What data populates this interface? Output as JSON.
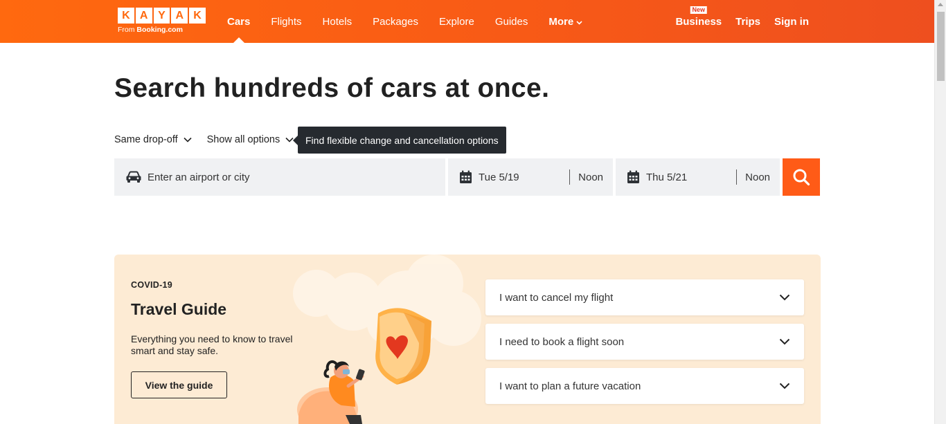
{
  "header": {
    "logo_letters": [
      "K",
      "A",
      "Y",
      "A",
      "K"
    ],
    "logo_from": "From",
    "logo_brand": "Booking.com",
    "nav": [
      {
        "label": "Cars",
        "active": true
      },
      {
        "label": "Flights"
      },
      {
        "label": "Hotels"
      },
      {
        "label": "Packages"
      },
      {
        "label": "Explore"
      },
      {
        "label": "Guides"
      },
      {
        "label": "More",
        "has_dropdown": true
      }
    ],
    "business_badge": "New",
    "business_label": "Business",
    "trips_label": "Trips",
    "signin_label": "Sign in"
  },
  "hero": {
    "title": "Search hundreds of cars at once.",
    "dropoff_option": "Same drop-off",
    "show_options": "Show all options",
    "tooltip": "Find flexible change and cancellation options"
  },
  "search": {
    "location_placeholder": "Enter an airport or city",
    "pickup_date": "Tue 5/19",
    "pickup_time": "Noon",
    "dropoff_date": "Thu 5/21",
    "dropoff_time": "Noon"
  },
  "covid": {
    "tag": "COVID-19",
    "title": "Travel Guide",
    "description": "Everything you need to know to travel smart and stay safe.",
    "button": "View the guide",
    "faqs": [
      "I want to cancel my flight",
      "I need to book a flight soon",
      "I want to plan a future vacation"
    ]
  },
  "colors": {
    "brand_orange": "#ff690f",
    "search_button": "#ff5b17",
    "card_background": "#fdebd4",
    "tooltip_background": "#262a2f"
  }
}
